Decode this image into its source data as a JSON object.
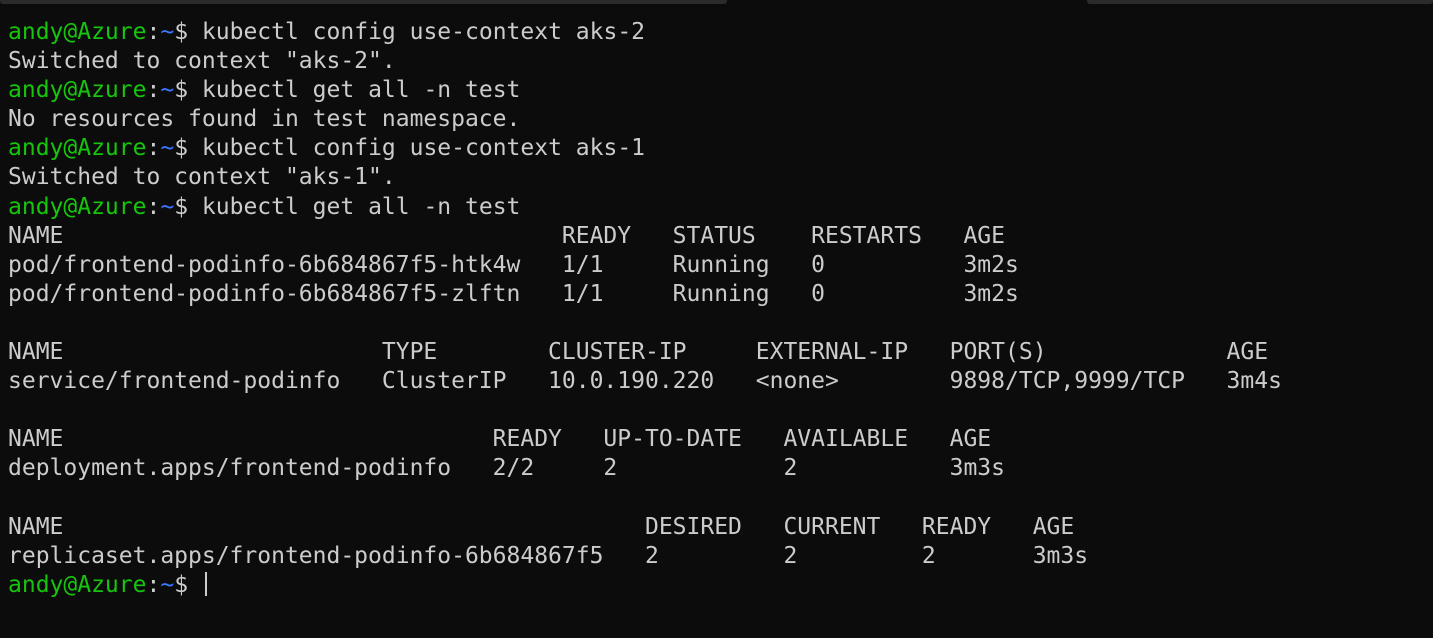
{
  "prompt": {
    "user_host": "andy@Azure",
    "sep": ":",
    "path": "~",
    "sigil": "$"
  },
  "lines": [
    {
      "type": "prompt",
      "command": "kubectl config use-context aks-2"
    },
    {
      "type": "output",
      "text": "Switched to context \"aks-2\"."
    },
    {
      "type": "prompt",
      "command": "kubectl get all -n test"
    },
    {
      "type": "output",
      "text": "No resources found in test namespace."
    },
    {
      "type": "prompt",
      "command": "kubectl config use-context aks-1"
    },
    {
      "type": "output",
      "text": "Switched to context \"aks-1\"."
    },
    {
      "type": "prompt",
      "command": "kubectl get all -n test"
    },
    {
      "type": "table",
      "columns": [
        "NAME",
        "READY",
        "STATUS",
        "RESTARTS",
        "AGE"
      ],
      "widths": [
        40,
        8,
        10,
        11,
        0
      ],
      "rows": [
        [
          "pod/frontend-podinfo-6b684867f5-htk4w",
          "1/1",
          "Running",
          "0",
          "3m2s"
        ],
        [
          "pod/frontend-podinfo-6b684867f5-zlftn",
          "1/1",
          "Running",
          "0",
          "3m2s"
        ]
      ]
    },
    {
      "type": "blank"
    },
    {
      "type": "table",
      "columns": [
        "NAME",
        "TYPE",
        "CLUSTER-IP",
        "EXTERNAL-IP",
        "PORT(S)",
        "AGE"
      ],
      "widths": [
        27,
        12,
        15,
        14,
        20,
        0
      ],
      "rows": [
        [
          "service/frontend-podinfo",
          "ClusterIP",
          "10.0.190.220",
          "<none>",
          "9898/TCP,9999/TCP",
          "3m4s"
        ]
      ]
    },
    {
      "type": "blank"
    },
    {
      "type": "table",
      "columns": [
        "NAME",
        "READY",
        "UP-TO-DATE",
        "AVAILABLE",
        "AGE"
      ],
      "widths": [
        35,
        8,
        13,
        12,
        0
      ],
      "rows": [
        [
          "deployment.apps/frontend-podinfo",
          "2/2",
          "2",
          "2",
          "3m3s"
        ]
      ]
    },
    {
      "type": "blank"
    },
    {
      "type": "table",
      "columns": [
        "NAME",
        "DESIRED",
        "CURRENT",
        "READY",
        "AGE"
      ],
      "widths": [
        46,
        10,
        10,
        8,
        0
      ],
      "rows": [
        [
          "replicaset.apps/frontend-podinfo-6b684867f5",
          "2",
          "2",
          "2",
          "3m3s"
        ]
      ]
    },
    {
      "type": "prompt",
      "command": "",
      "cursor": true
    }
  ]
}
